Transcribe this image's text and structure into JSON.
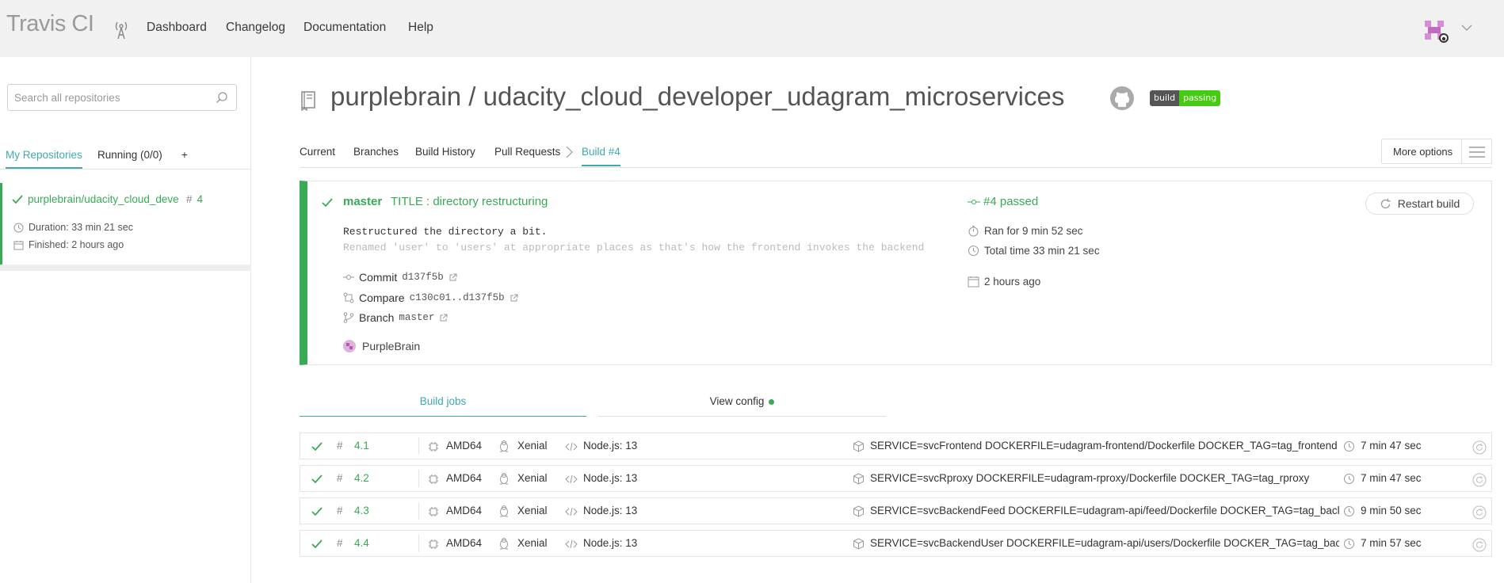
{
  "topbar": {
    "brand": "Travis CI",
    "nav": [
      "Dashboard",
      "Changelog",
      "Documentation",
      "Help"
    ]
  },
  "sidebar": {
    "search_placeholder": "Search all repositories",
    "tabs": [
      "My Repositories",
      "Running (0/0)",
      "+"
    ],
    "repo": {
      "name": "purplebrain/udacity_cloud_developer_udagram_microservices",
      "build_number": "4",
      "duration": "Duration: 33 min 21 sec",
      "finished": "Finished: 2 hours ago"
    }
  },
  "repo_header": {
    "title": "purplebrain / udacity_cloud_developer_udagram_microservices",
    "badge_left": "build",
    "badge_right": "passing"
  },
  "main_tabs": [
    "Current",
    "Branches",
    "Build History",
    "Pull Requests",
    "Build #4"
  ],
  "more_options": "More options",
  "build": {
    "branch": "master",
    "title": "TITLE : directory restructuring",
    "message_line1": "Restructured the directory a bit.",
    "message_line2": "Renamed 'user' to 'users' at appropriate places as that's how the frontend invokes the backend",
    "commit_label": "Commit",
    "commit_value": "d137f5b",
    "compare_label": "Compare",
    "compare_value": "c130c01..d137f5b",
    "branch_label": "Branch",
    "branch_value": "master",
    "author": "PurpleBrain",
    "status": "#4 passed",
    "ran_for": "Ran for 9 min 52 sec",
    "total_time": "Total time 33 min 21 sec",
    "when": "2 hours ago",
    "restart_label": "Restart build"
  },
  "job_tabs": {
    "build_jobs": "Build jobs",
    "view_config": "View config"
  },
  "jobs": [
    {
      "number": "4.1",
      "arch": "AMD64",
      "os": "Xenial",
      "lang": "Node.js: 13",
      "env": "SERVICE=svcFrontend DOCKERFILE=udagram-frontend/Dockerfile DOCKER_TAG=tag_frontend",
      "duration": "7 min 47 sec"
    },
    {
      "number": "4.2",
      "arch": "AMD64",
      "os": "Xenial",
      "lang": "Node.js: 13",
      "env": "SERVICE=svcRproxy DOCKERFILE=udagram-rproxy/Dockerfile DOCKER_TAG=tag_rproxy",
      "duration": "7 min 47 sec"
    },
    {
      "number": "4.3",
      "arch": "AMD64",
      "os": "Xenial",
      "lang": "Node.js: 13",
      "env": "SERVICE=svcBackendFeed DOCKERFILE=udagram-api/feed/Dockerfile DOCKER_TAG=tag_backendfeed",
      "duration": "9 min 50 sec"
    },
    {
      "number": "4.4",
      "arch": "AMD64",
      "os": "Xenial",
      "lang": "Node.js: 13",
      "env": "SERVICE=svcBackendUser DOCKERFILE=udagram-api/users/Dockerfile DOCKER_TAG=tag_backenduser",
      "duration": "7 min 57 sec"
    }
  ],
  "colors": {
    "passed": "#39aa56",
    "accent": "#3eaaaf",
    "topbar": "#f1f1f1"
  }
}
